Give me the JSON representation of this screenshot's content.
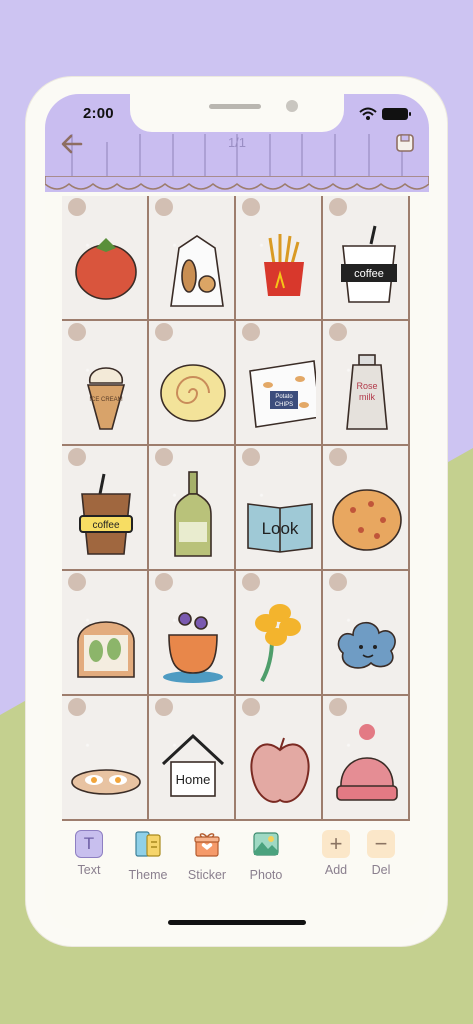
{
  "status_bar": {
    "time": "2:00"
  },
  "header": {
    "page_indicator": "1/1"
  },
  "stickers": [
    [
      "tomato-sticker",
      "bread-bag-sticker",
      "fries-sticker",
      "coffee-cup-sticker"
    ],
    [
      "ice-cream-sticker",
      "swiss-roll-sticker",
      "chips-bag-sticker",
      "rose-milk-sticker"
    ],
    [
      "iced-coffee-sticker",
      "wine-bottle-sticker",
      "book-sticker",
      "pizza-sticker"
    ],
    [
      "avocado-toast-sticker",
      "flower-cup-sticker",
      "yellow-flower-sticker",
      "cloud-sticker"
    ],
    [
      "fried-eggs-sticker",
      "home-sticker",
      "apple-sticker",
      "beanie-sticker"
    ]
  ],
  "sticker_text": {
    "coffee": "coffee",
    "ice_cream": "ICE CREAM",
    "chips_1": "Potato",
    "chips_2": "CHIPS",
    "rose_milk_1": "Rose",
    "rose_milk_2": "milk",
    "iced_coffee": "coffee",
    "book": "Look",
    "home": "Home"
  },
  "toolbar": {
    "text_label": "Text",
    "theme_label": "Theme",
    "sticker_label": "Sticker",
    "photo_label": "Photo",
    "add_label": "Add",
    "del_label": "Del",
    "text_icon_glyph": "T",
    "add_icon_glyph": "+",
    "del_icon_glyph": "−"
  },
  "colors": {
    "header": "#c9bdf0",
    "background_purple": "#cdc4f2",
    "background_green": "#c4d08f",
    "grid_line": "#9d7d6d",
    "dot": "#d2bfb3",
    "label": "#8a7f8e"
  }
}
